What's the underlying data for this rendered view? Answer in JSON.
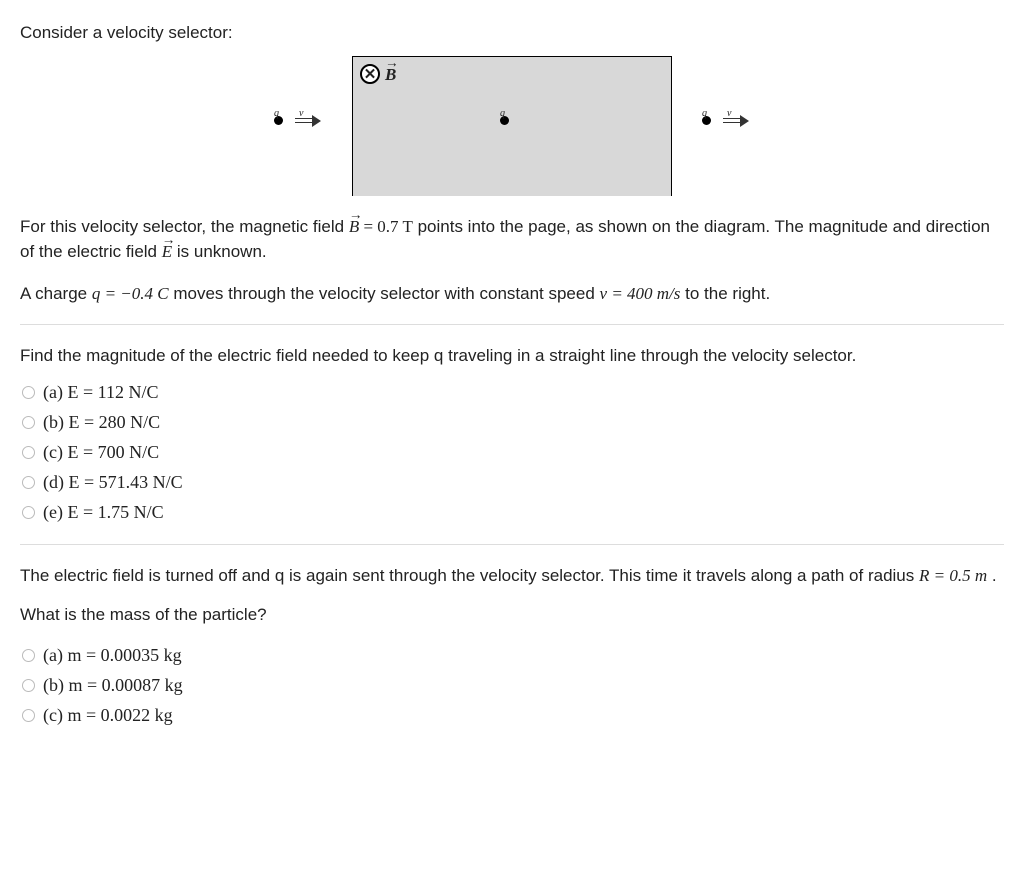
{
  "intro": "Consider a velocity selector:",
  "diagram": {
    "b_symbol": "✕",
    "b_label": "B",
    "q_label": "q",
    "v_label": "v"
  },
  "para1_pre": "For this velocity selector, the magnetic field ",
  "para1_vec1": "B",
  "para1_b_eq": " = 0.7 T",
  "para1_mid": " points into the page, as shown on the diagram. The magnitude and direction of the electric field ",
  "para1_vec2": "E",
  "para1_end": " is unknown.",
  "para2_pre": "A charge ",
  "para2_q": "q = −0.4 C",
  "para2_mid": " moves through the velocity selector with constant speed ",
  "para2_v": "v = 400 m/s",
  "para2_end": " to the right.",
  "q1_text": "Find the magnitude of the electric field needed to keep q traveling in a straight line through the velocity selector.",
  "q1_options": [
    "(a) E = 112 N/C",
    "(b) E = 280 N/C",
    "(c) E = 700 N/C",
    "(d) E = 571.43 N/C",
    "(e) E = 1.75 N/C"
  ],
  "q2_text_pre": "The electric field is turned off and q is again sent through the velocity selector. This time it travels along a path of radius ",
  "q2_r": "R = 0.5 m",
  "q2_text_end": " .",
  "q2_prompt": "What is the mass of the particle?",
  "q2_options": [
    "(a) m = 0.00035 kg",
    "(b) m = 0.00087 kg",
    "(c) m = 0.0022 kg"
  ]
}
